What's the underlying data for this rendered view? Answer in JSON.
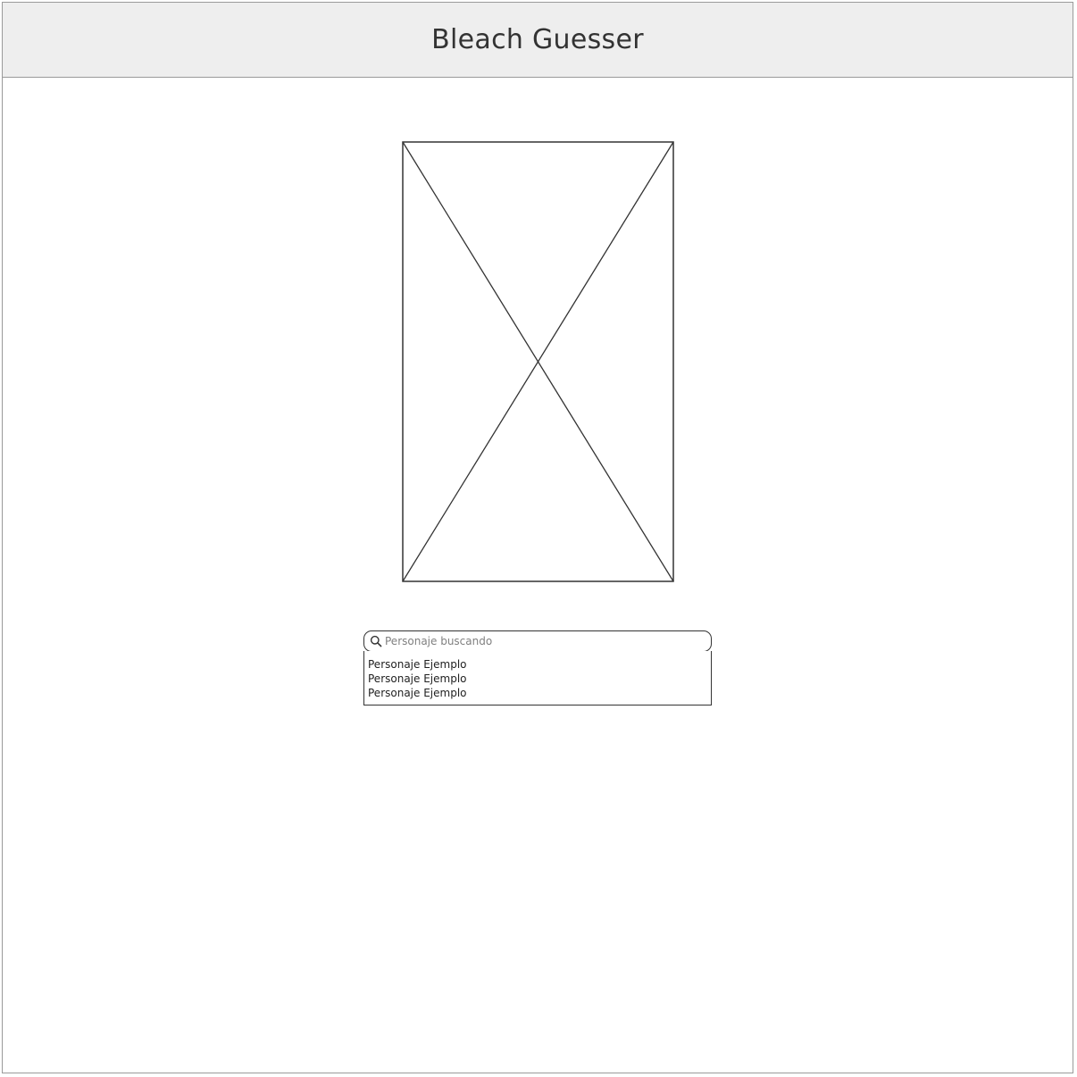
{
  "app": {
    "title": "Bleach Guesser"
  },
  "image_placeholder": {
    "icon": "image-placeholder-x"
  },
  "search": {
    "placeholder": "Personaje buscando",
    "value": "",
    "icon": "search-icon"
  },
  "results": [
    {
      "label": "Personaje Ejemplo"
    },
    {
      "label": "Personaje Ejemplo"
    },
    {
      "label": "Personaje Ejemplo"
    }
  ],
  "colors": {
    "titlebar_bg": "#eeeeee",
    "stroke": "#333333",
    "frame_border": "#9a9a9a",
    "placeholder_text": "#808080"
  }
}
